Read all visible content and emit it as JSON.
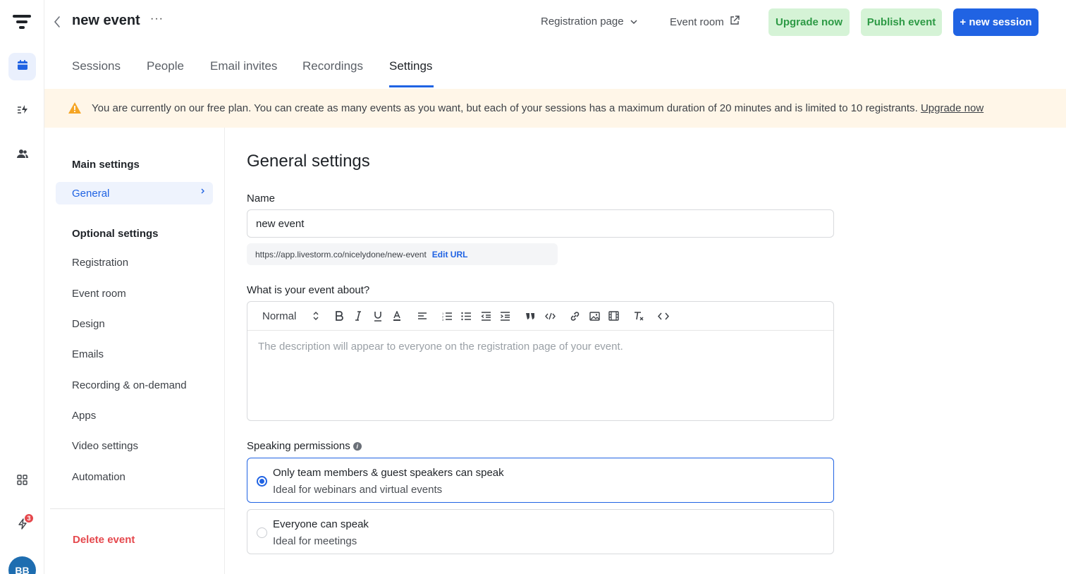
{
  "header": {
    "title": "new event",
    "more": "···",
    "registration_page": "Registration page",
    "event_room": "Event room",
    "upgrade_now": "Upgrade now",
    "publish_event": "Publish event",
    "new_session": "+ new session"
  },
  "tabs": [
    "Sessions",
    "People",
    "Email invites",
    "Recordings",
    "Settings"
  ],
  "active_tab": "Settings",
  "banner": {
    "text": "You are currently on our free plan. You can create as many events as you want, but each of your sessions has a maximum duration of 20 minutes and is limited to 10 registrants.",
    "link": "Upgrade now"
  },
  "settings_nav": {
    "main_heading": "Main settings",
    "general": "General",
    "optional_heading": "Optional settings",
    "items": [
      "Registration",
      "Event room",
      "Design",
      "Emails",
      "Recording & on-demand",
      "Apps",
      "Video settings",
      "Automation"
    ],
    "delete": "Delete event"
  },
  "main": {
    "title": "General settings",
    "name_label": "Name",
    "name_value": "new event",
    "url": "https://app.livestorm.co/nicelydone/new-event",
    "edit_url": "Edit URL",
    "about_label": "What is your event about?",
    "format_select": "Normal",
    "description_placeholder": "The description will appear to everyone on the registration page of your event.",
    "speaking_label": "Speaking permissions",
    "options": [
      {
        "title": "Only team members & guest speakers can speak",
        "subtitle": "Ideal for webinars and virtual events",
        "selected": true
      },
      {
        "title": "Everyone can speak",
        "subtitle": "Ideal for meetings",
        "selected": false
      }
    ]
  },
  "rail": {
    "notification_count": "3",
    "avatar_initials": "BB"
  },
  "colors": {
    "accent": "#2063e3",
    "green_btn_bg": "#d5f3d6",
    "green_btn_text": "#2d9a45",
    "danger": "#e5484d",
    "banner_bg": "#fff6e8",
    "warning": "#f5a524"
  }
}
